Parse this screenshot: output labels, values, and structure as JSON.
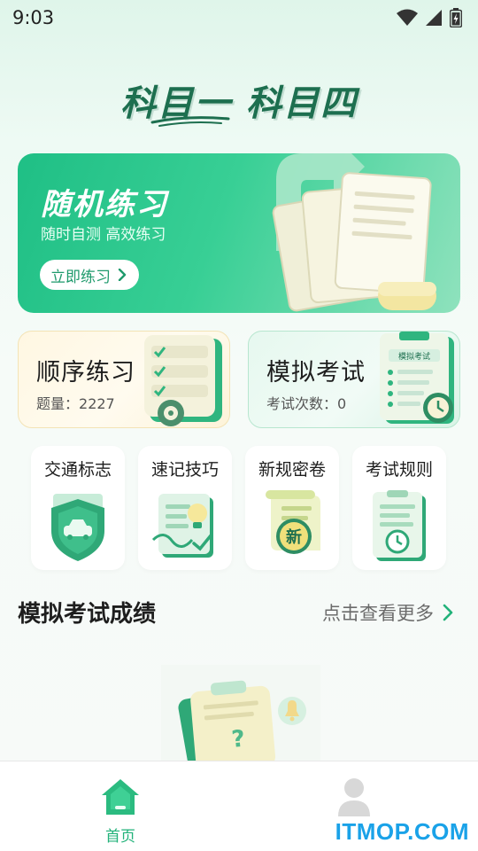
{
  "status_bar": {
    "time": "9:03"
  },
  "app_title": "科目一 科目四",
  "hero": {
    "title": "随机练习",
    "subtitle": "随时自测 高效练习",
    "button_label": "立即练习"
  },
  "cards": {
    "order": {
      "title": "顺序练习",
      "sub_label": "题量：",
      "sub_value": "2227"
    },
    "exam": {
      "title": "模拟考试",
      "sub_label": "考试次数：",
      "sub_value": "0",
      "badge": "模拟考试"
    }
  },
  "quick_items": [
    {
      "label": "交通标志",
      "icon": "traffic-sign-shield-icon"
    },
    {
      "label": "速记技巧",
      "icon": "lightbulb-doc-icon"
    },
    {
      "label": "新规密卷",
      "icon": "new-scroll-icon"
    },
    {
      "label": "考试规则",
      "icon": "clock-clipboard-icon"
    }
  ],
  "new_badge": "新",
  "results_section": {
    "title": "模拟考试成绩",
    "more_label": "点击查看更多"
  },
  "bottom_nav": {
    "home_label": "首页"
  },
  "watermark": "ITMOP.COM",
  "colors": {
    "primary": "#22b27a",
    "hero_start": "#1fbf85",
    "hero_end": "#8fe2bd",
    "order_card_bg": "#fff7e2",
    "exam_card_bg": "#e6f8ef"
  }
}
